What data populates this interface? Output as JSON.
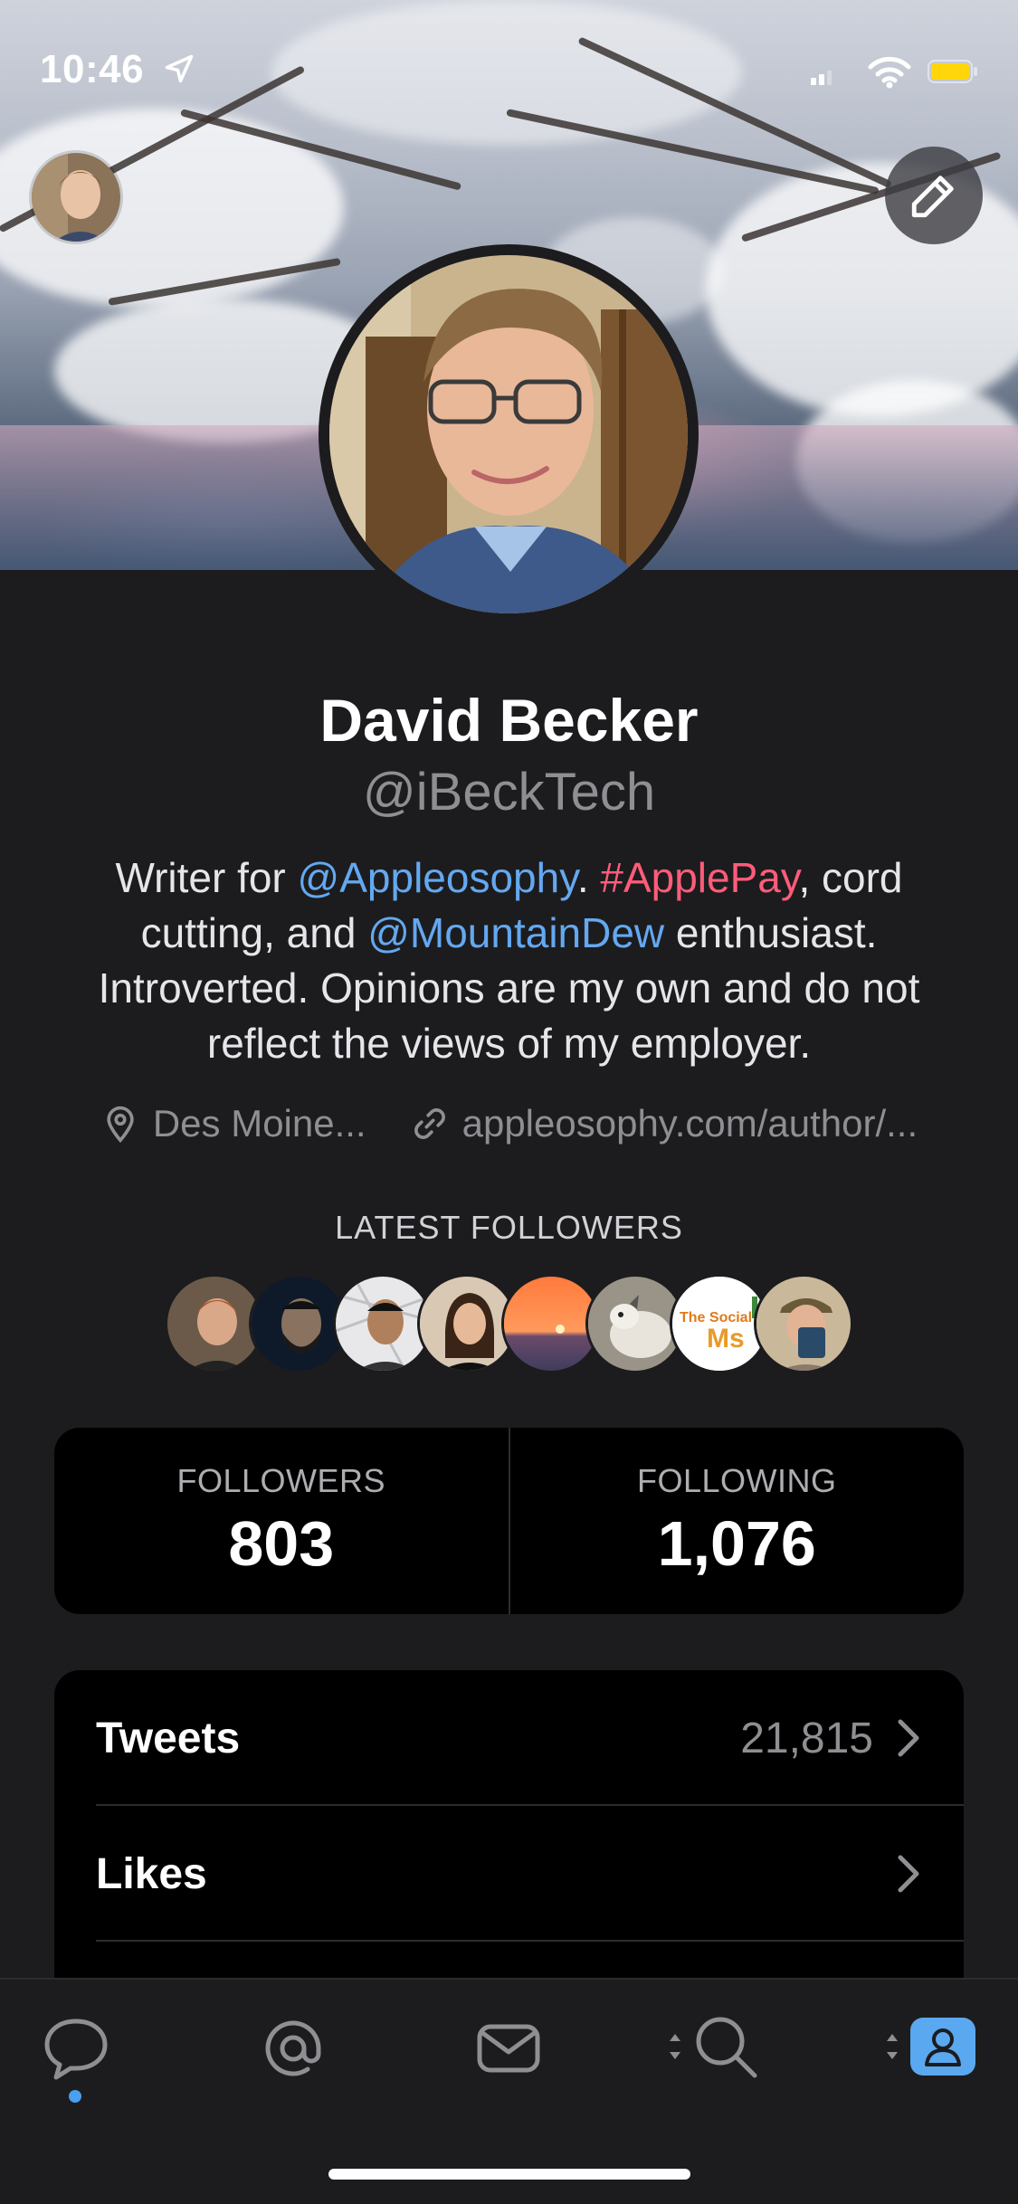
{
  "status_bar": {
    "time": "10:46"
  },
  "profile": {
    "name": "David Becker",
    "handle": "@iBeckTech",
    "bio": {
      "t1": "Writer for ",
      "m1": "@Appleosophy",
      "t2": ". ",
      "h1": "#ApplePay",
      "t3": ", cord cutting, and ",
      "m2": "@MountainDew",
      "t4": " enthusiast. Introverted. Opinions are my own and do not reflect the views of my employer."
    },
    "location": "Des Moine...",
    "website": "appleosophy.com/author/...",
    "location_icon": "map-pin-icon",
    "website_icon": "link-icon"
  },
  "latest_followers": {
    "label": "LATEST FOLLOWERS",
    "avatar_text": "The Social Ms"
  },
  "stats": {
    "followers_label": "FOLLOWERS",
    "followers_value": "803",
    "following_label": "FOLLOWING",
    "following_value": "1,076"
  },
  "list": [
    {
      "label": "Tweets",
      "count": "21,815"
    },
    {
      "label": "Likes",
      "count": ""
    }
  ],
  "tabbar": {
    "tabs": [
      "timeline-icon",
      "mentions-icon",
      "messages-icon",
      "search-icon",
      "profile-icon"
    ]
  },
  "colors": {
    "background": "#1c1c1e",
    "card": "#000000",
    "mention": "#64a8f0",
    "hashtag": "#ff5c7a",
    "accent": "#5aa8ef"
  }
}
